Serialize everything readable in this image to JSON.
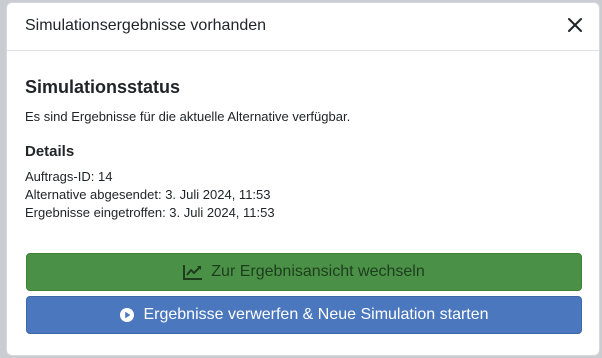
{
  "modal": {
    "title": "Simulationsergebnisse vorhanden",
    "close_icon": "close-icon"
  },
  "status": {
    "heading": "Simulationsstatus",
    "text": "Es sind Ergebnisse für die aktuelle Alternative verfügbar."
  },
  "details": {
    "heading": "Details",
    "lines": [
      "Auftrags-ID: 14",
      "Alternative abgesendet: 3. Juli 2024, 11:53",
      "Ergebnisse eingetroffen: 3. Juli 2024, 11:53"
    ]
  },
  "actions": {
    "view_results": {
      "label": "Zur Ergebnisansicht wechseln",
      "icon": "line-chart-icon",
      "color": "#4a9147"
    },
    "discard_restart": {
      "label": "Ergebnisse verwerfen & Neue Simulation starten",
      "icon": "play-circle-icon",
      "color": "#4a77bd"
    }
  }
}
